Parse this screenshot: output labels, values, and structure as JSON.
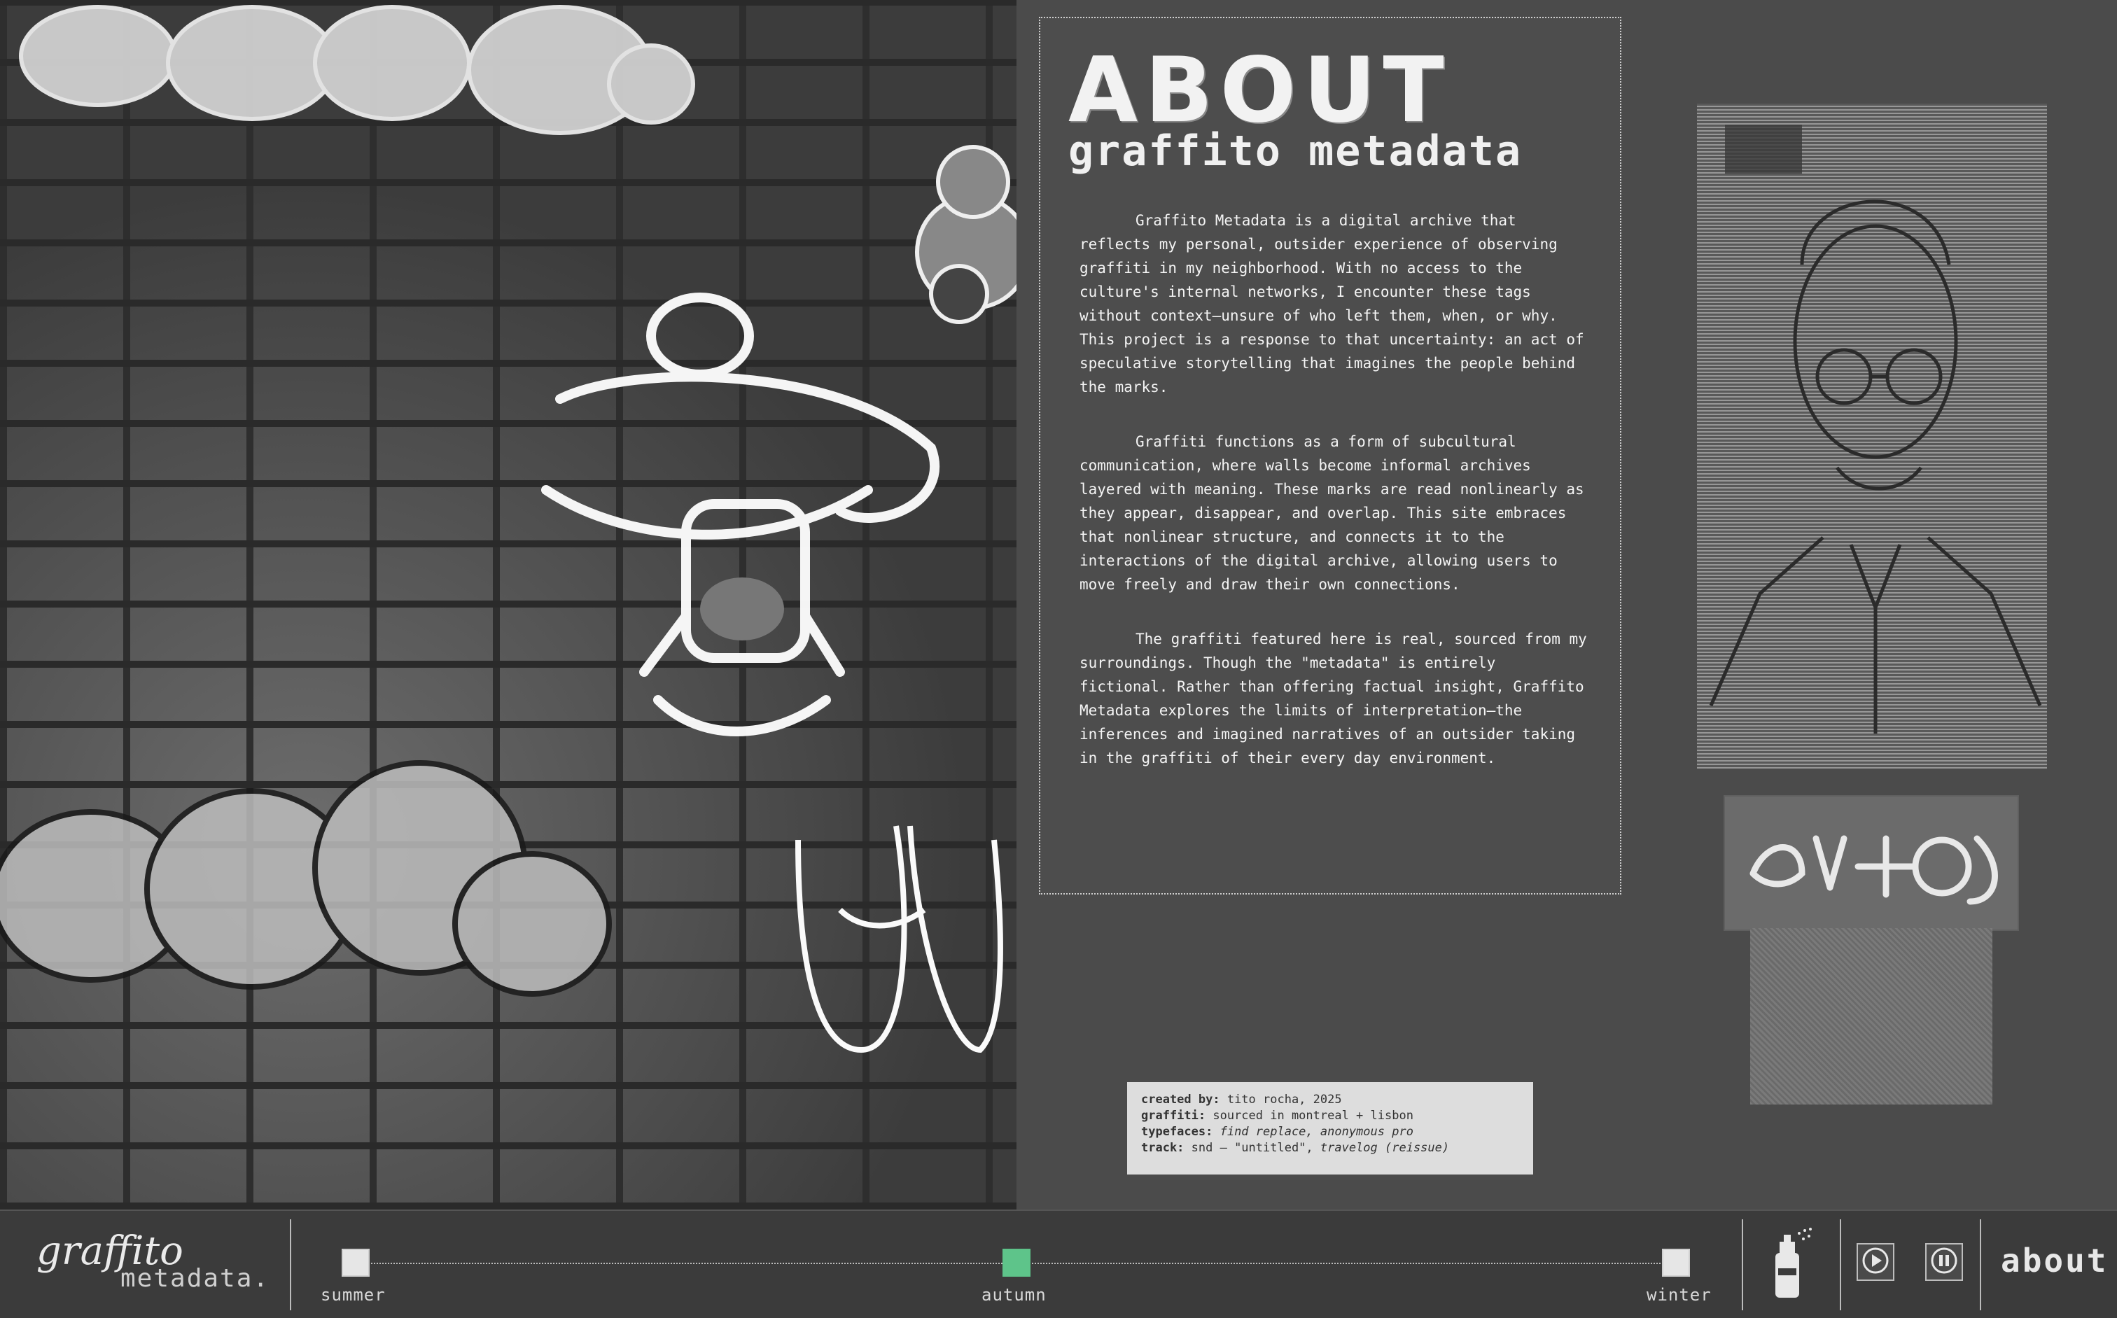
{
  "about": {
    "title": "ABOUT",
    "subtitle": "graffito metadata",
    "paragraphs": [
      "Graffito Metadata is a digital archive that reflects my personal, outsider experience of observing graffiti in my neighborhood. With no access to the culture's internal networks, I encounter these tags without context—unsure of who left them, when, or why. This project is a response to that uncertainty: an act of speculative storytelling that imagines the people behind the marks.",
      "Graffiti functions as a form of subcultural communication, where walls become informal archives layered with meaning. These marks are read nonlinearly as they appear, disappear, and overlap. This site embraces that nonlinear structure, and connects it to the interactions of the digital archive, allowing users to move freely and draw their own connections.",
      "The graffiti featured here is real, sourced from my surroundings. Though the \"metadata\" is entirely fictional. Rather than offering factual insight, Graffito Metadata explores the limits of interpretation—the inferences and imagined narratives of an outsider taking in the graffiti of their every day environment."
    ]
  },
  "credits": {
    "created_label": "created by:",
    "created_value": " tito rocha, 2025",
    "graffiti_label": "graffiti:",
    "graffiti_value": " sourced in montreal + lisbon",
    "typefaces_label": "typefaces:",
    "typefaces_value": " find replace, anonymous pro",
    "track_label": "track:",
    "track_value_plain": " snd – \"untitled\", ",
    "track_value_italic": "travelog (reissue)"
  },
  "logo": {
    "script": "graffito",
    "mono": "metadata."
  },
  "timeline": {
    "seasons": [
      {
        "label": "summer",
        "active": false
      },
      {
        "label": "autumn",
        "active": true
      },
      {
        "label": "winter",
        "active": false
      }
    ]
  },
  "nav": {
    "about_label": "about"
  },
  "icons": {
    "spray": "spray-can-icon",
    "play": "play-icon",
    "pause": "pause-icon"
  },
  "colors": {
    "active_season": "#5ec48a",
    "background": "#4a4a4a"
  }
}
